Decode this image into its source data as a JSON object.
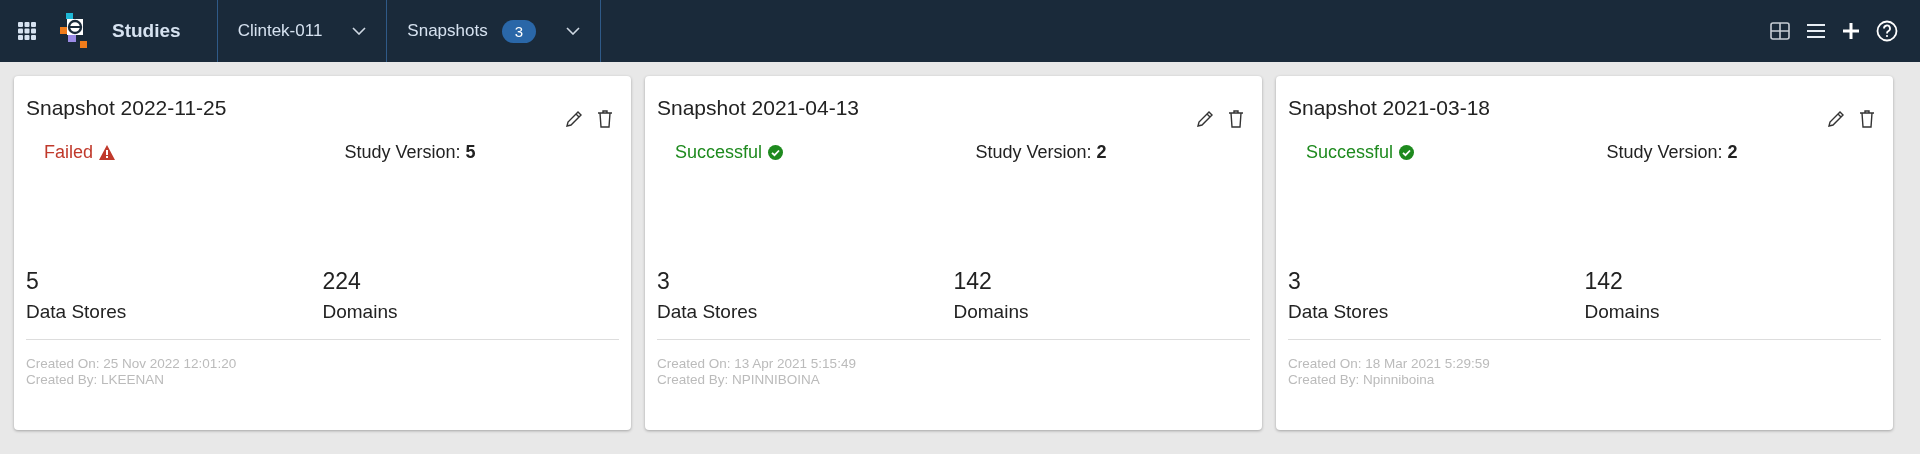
{
  "header": {
    "app_title": "Studies",
    "study_dropdown": {
      "label": "Clintek-011"
    },
    "snapshots_dropdown": {
      "label": "Snapshots",
      "count": "3"
    }
  },
  "snapshots": [
    {
      "title": "Snapshot 2022-11-25",
      "status": {
        "kind": "failed",
        "label": "Failed"
      },
      "version": "Study Version: **5**",
      "stats": [
        {
          "value": "5",
          "label": "Data Stores"
        },
        {
          "value": "224",
          "label": "Domains"
        }
      ],
      "created_on": "Created On: 25 Nov 2022 12:01:20",
      "created_by": "Created By: LKEENAN"
    },
    {
      "title": "Snapshot 2021-04-13",
      "status": {
        "kind": "success",
        "label": "Successful"
      },
      "version": "Study Version: **2**",
      "stats": [
        {
          "value": "3",
          "label": "Data Stores"
        },
        {
          "value": "142",
          "label": "Domains"
        }
      ],
      "created_on": "Created On: 13 Apr 2021 5:15:49",
      "created_by": "Created By: NPINNIBOINA"
    },
    {
      "title": "Snapshot 2021-03-18",
      "status": {
        "kind": "success",
        "label": "Successful"
      },
      "version": "Study Version: **2**",
      "stats": [
        {
          "value": "3",
          "label": "Data Stores"
        },
        {
          "value": "142",
          "label": "Domains"
        }
      ],
      "created_on": "Created On: 18 Mar 2021 5:29:59",
      "created_by": "Created By: Npinniboina"
    }
  ]
}
